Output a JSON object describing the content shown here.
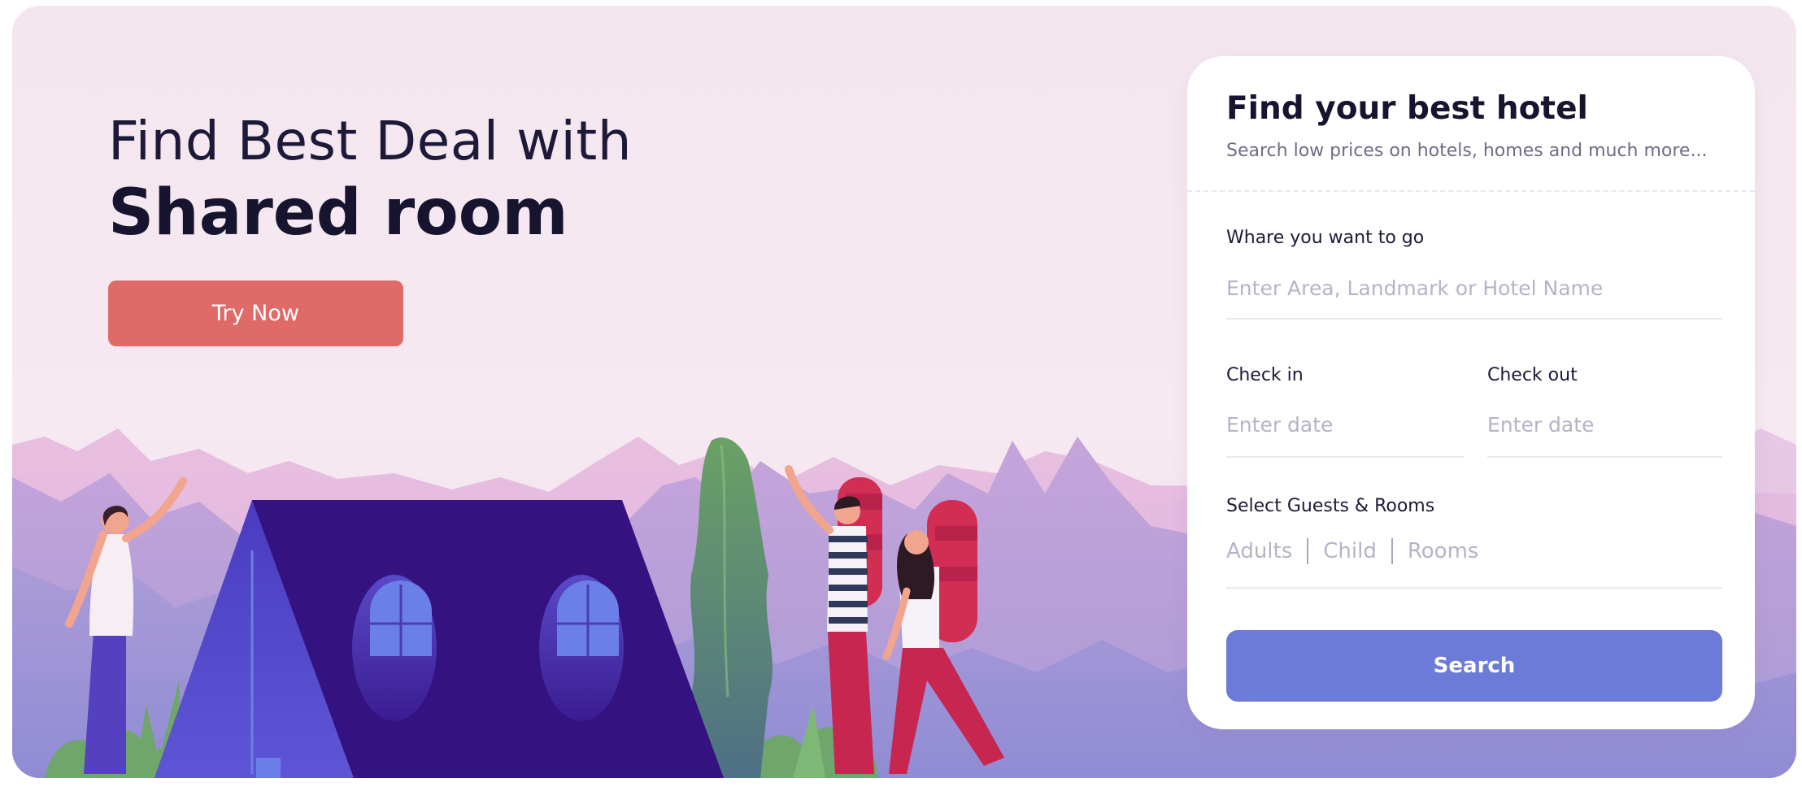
{
  "hero": {
    "headline_line1": "Find Best Deal with",
    "headline_line2": "Shared room",
    "cta_label": "Try Now"
  },
  "search_card": {
    "title": "Find your best hotel",
    "subtitle": "Search low prices on hotels, homes and much more...",
    "destination": {
      "label": "Whare you want to go",
      "placeholder": "Enter Area, Landmark or Hotel Name",
      "value": ""
    },
    "check_in": {
      "label": "Check in",
      "placeholder": "Enter date",
      "value": ""
    },
    "check_out": {
      "label": "Check out",
      "placeholder": "Enter date",
      "value": ""
    },
    "guests": {
      "label": "Select Guests & Rooms",
      "options": [
        "Adults",
        "Child",
        "Rooms"
      ]
    },
    "search_label": "Search"
  },
  "colors": {
    "accent_cta": "#e06a67",
    "search_button": "#6c7bd8",
    "tent": "#34127f",
    "text_dark": "#16142e"
  },
  "illustration": {
    "subject": "camping scene with tent, mountains, plants and travellers with backpacks"
  }
}
